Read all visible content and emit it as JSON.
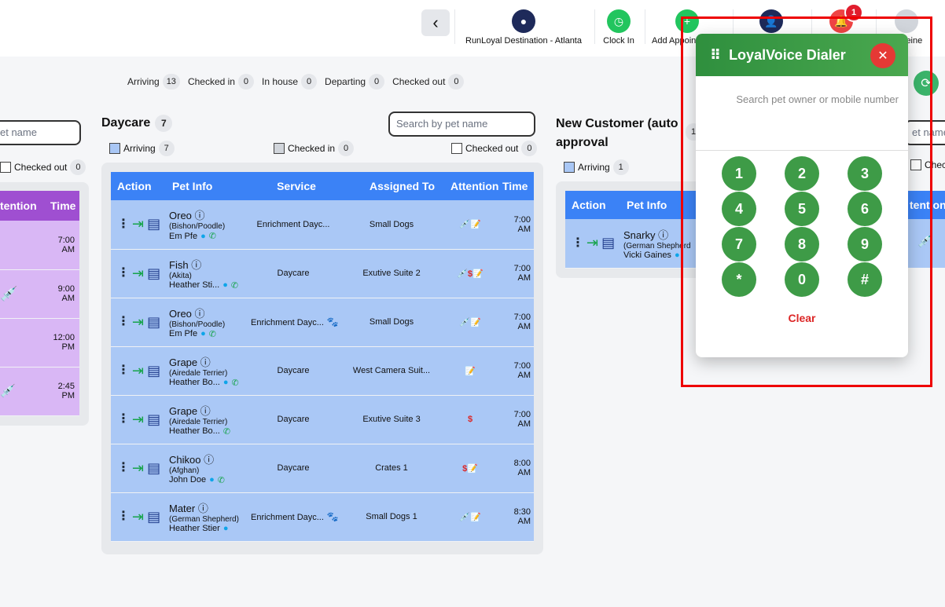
{
  "header": {
    "location": "RunLoyal Destination - Atlanta",
    "clock_in": "Clock In",
    "add_appointment": "Add Appoin",
    "notifications_count": "1",
    "user": "leine"
  },
  "summary": [
    {
      "label": "Arriving",
      "count": "13"
    },
    {
      "label": "Checked in",
      "count": "0"
    },
    {
      "label": "In house",
      "count": "0"
    },
    {
      "label": "Departing",
      "count": "0"
    },
    {
      "label": "Checked out",
      "count": "0"
    }
  ],
  "left_column": {
    "search_placeholder": "et name",
    "checked_out_label": "Checked out",
    "checked_out_count": "0",
    "headers": [
      "tention",
      "Time"
    ],
    "times": [
      "7:00 AM",
      "9:00 AM",
      "12:00 PM",
      "2:45 PM"
    ]
  },
  "daycare": {
    "title": "Daycare",
    "count": "7",
    "search_placeholder": "Search by pet name",
    "filters": [
      {
        "label": "Arriving",
        "count": "7"
      },
      {
        "label": "Checked in",
        "count": "0"
      },
      {
        "label": "Checked out",
        "count": "0"
      }
    ],
    "headers": [
      "Action",
      "Pet Info",
      "Service",
      "Assigned To",
      "Attention",
      "Time"
    ],
    "rows": [
      {
        "name": "Oreo",
        "breed": "(Bishon/Poodle)",
        "owner": "Em Pfe",
        "service": "Enrichment Dayc...",
        "assigned": "Small Dogs",
        "attention": "💉📝",
        "time": "7:00 AM"
      },
      {
        "name": "Fish",
        "breed": "(Akita)",
        "owner": "Heather Sti...",
        "service": "Daycare",
        "assigned": "Exutive Suite 2",
        "attention": "💉$📝",
        "time": "7:00 AM"
      },
      {
        "name": "Oreo",
        "breed": "(Bishon/Poodle)",
        "owner": "Em Pfe",
        "service": "Enrichment Dayc...",
        "assigned": "Small Dogs",
        "attention": "💉📝",
        "time": "7:00 AM"
      },
      {
        "name": "Grape",
        "breed": "(Airedale Terrier)",
        "owner": "Heather Bo...",
        "service": "Daycare",
        "assigned": "West Camera Suit...",
        "attention": "📝",
        "time": "7:00 AM"
      },
      {
        "name": "Grape",
        "breed": "(Airedale Terrier)",
        "owner": "Heather Bo...",
        "service": "Daycare",
        "assigned": "Exutive Suite 3",
        "attention": "$",
        "time": "7:00 AM"
      },
      {
        "name": "Chikoo",
        "breed": "(Afghan)",
        "owner": "John Doe",
        "service": "Daycare",
        "assigned": "Crates 1",
        "attention": "$📝",
        "time": "8:00 AM"
      },
      {
        "name": "Mater",
        "breed": "(German Shepherd)",
        "owner": "Heather Stier",
        "service": "Enrichment Dayc...",
        "assigned": "Small Dogs 1",
        "attention": "💉📝",
        "time": "8:30 AM"
      }
    ]
  },
  "new_customer": {
    "title": "New Customer (auto approval",
    "count": "1",
    "filters": [
      {
        "label": "Arriving",
        "count": "1"
      }
    ],
    "search_placeholder": "et name",
    "checked_label": "Check",
    "headers": [
      "Action",
      "Pet Info",
      "tention"
    ],
    "rows": [
      {
        "name": "Snarky",
        "breed": "(German Shepherd",
        "owner": "Vicki Gaines"
      }
    ]
  },
  "dialer": {
    "title": "LoyalVoice Dialer",
    "search_placeholder": "Search pet owner or mobile number",
    "keys": [
      "1",
      "2",
      "3",
      "4",
      "5",
      "6",
      "7",
      "8",
      "9",
      "*",
      "0",
      "#"
    ],
    "clear_label": "Clear"
  },
  "colors": {
    "header_blue": "#3b82f6",
    "row_blue": "#aac8f6",
    "purple": "#9f4fd1",
    "dialer_green": "#3e9b47",
    "alert_red": "#dc2626"
  }
}
